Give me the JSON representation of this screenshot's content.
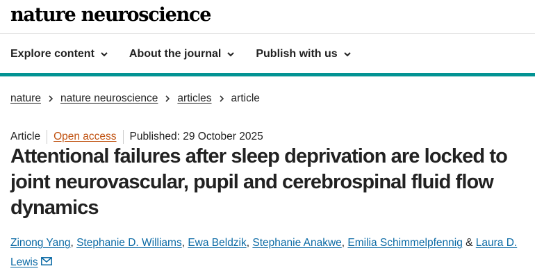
{
  "site": {
    "logo": "nature neuroscience"
  },
  "nav": {
    "items": [
      {
        "label": "Explore content",
        "icon": "chevron-down-icon"
      },
      {
        "label": "About the journal",
        "icon": "chevron-down-icon"
      },
      {
        "label": "Publish with us",
        "icon": "chevron-down-icon"
      }
    ]
  },
  "breadcrumb": {
    "items": [
      "nature",
      "nature neuroscience",
      "articles"
    ],
    "current": "article",
    "separator_icon": "chevron-right-icon"
  },
  "article": {
    "type": "Article",
    "access": "Open access",
    "published": "Published: 29 October 2025",
    "title": "Attentional failures after sleep deprivation are locked to joint neurovascular, pupil and cerebrospinal fluid flow dynamics",
    "authors": [
      "Zinong Yang",
      "Stephanie D. Williams",
      "Ewa Beldzik",
      "Stephanie Anakwe",
      "Emilia Schimmelpfennig",
      "Laura D. Lewis"
    ],
    "author_separator": ", ",
    "last_separator": " & ",
    "contact_icon": "mail-icon"
  },
  "colors": {
    "accent_bar": "#029393",
    "author_link": "#0b6aa5",
    "open_access": "#c0510f",
    "text": "#222222"
  }
}
